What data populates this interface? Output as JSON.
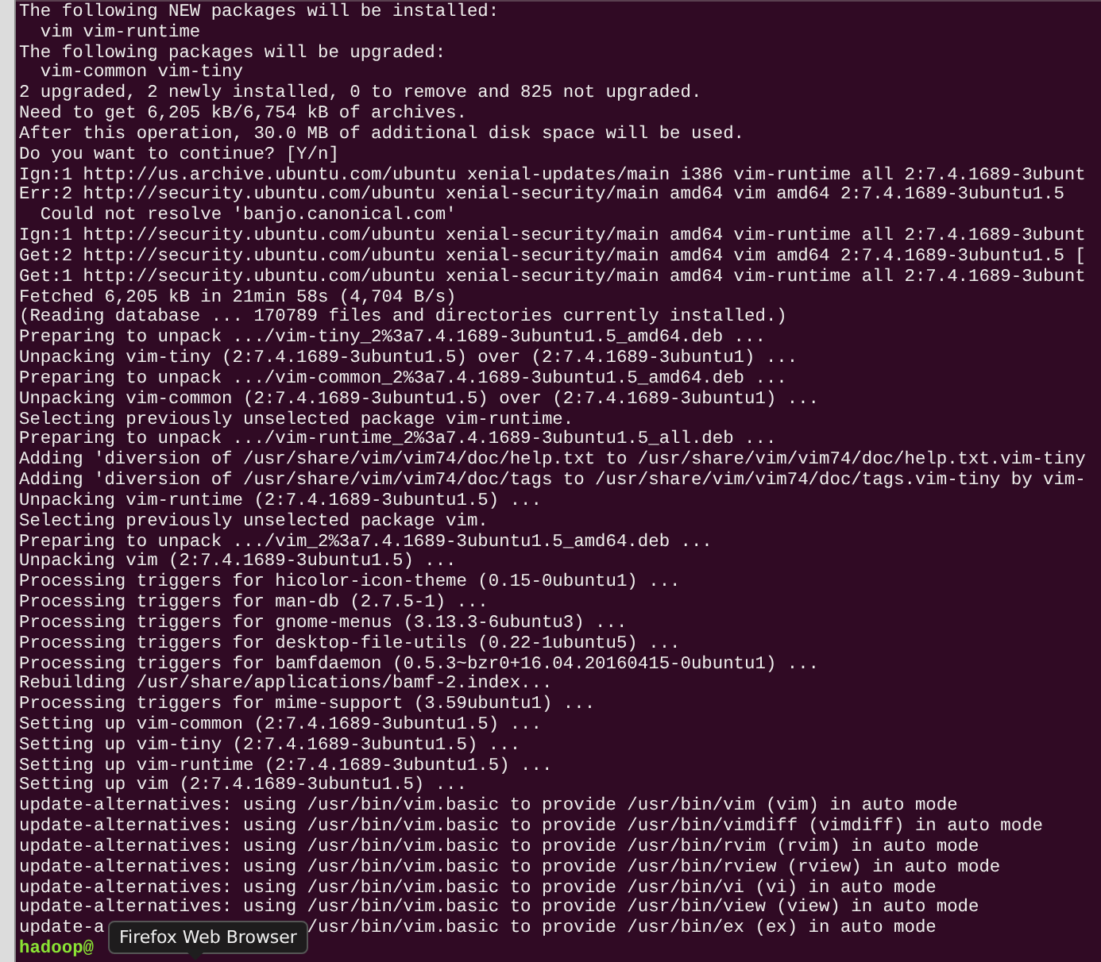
{
  "lines": [
    "The following NEW packages will be installed:",
    "  vim vim-runtime",
    "The following packages will be upgraded:",
    "  vim-common vim-tiny",
    "2 upgraded, 2 newly installed, 0 to remove and 825 not upgraded.",
    "Need to get 6,205 kB/6,754 kB of archives.",
    "After this operation, 30.0 MB of additional disk space will be used.",
    "Do you want to continue? [Y/n]",
    "Ign:1 http://us.archive.ubuntu.com/ubuntu xenial-updates/main i386 vim-runtime all 2:7.4.1689-3ubunt",
    "Err:2 http://security.ubuntu.com/ubuntu xenial-security/main amd64 vim amd64 2:7.4.1689-3ubuntu1.5",
    "  Could not resolve 'banjo.canonical.com'",
    "Ign:1 http://security.ubuntu.com/ubuntu xenial-security/main amd64 vim-runtime all 2:7.4.1689-3ubunt",
    "Get:2 http://security.ubuntu.com/ubuntu xenial-security/main amd64 vim amd64 2:7.4.1689-3ubuntu1.5 [",
    "Get:1 http://security.ubuntu.com/ubuntu xenial-security/main amd64 vim-runtime all 2:7.4.1689-3ubunt",
    "Fetched 6,205 kB in 21min 58s (4,704 B/s)",
    "(Reading database ... 170789 files and directories currently installed.)",
    "Preparing to unpack .../vim-tiny_2%3a7.4.1689-3ubuntu1.5_amd64.deb ...",
    "Unpacking vim-tiny (2:7.4.1689-3ubuntu1.5) over (2:7.4.1689-3ubuntu1) ...",
    "Preparing to unpack .../vim-common_2%3a7.4.1689-3ubuntu1.5_amd64.deb ...",
    "Unpacking vim-common (2:7.4.1689-3ubuntu1.5) over (2:7.4.1689-3ubuntu1) ...",
    "Selecting previously unselected package vim-runtime.",
    "Preparing to unpack .../vim-runtime_2%3a7.4.1689-3ubuntu1.5_all.deb ...",
    "Adding 'diversion of /usr/share/vim/vim74/doc/help.txt to /usr/share/vim/vim74/doc/help.txt.vim-tiny",
    "Adding 'diversion of /usr/share/vim/vim74/doc/tags to /usr/share/vim/vim74/doc/tags.vim-tiny by vim-",
    "Unpacking vim-runtime (2:7.4.1689-3ubuntu1.5) ...",
    "Selecting previously unselected package vim.",
    "Preparing to unpack .../vim_2%3a7.4.1689-3ubuntu1.5_amd64.deb ...",
    "Unpacking vim (2:7.4.1689-3ubuntu1.5) ...",
    "Processing triggers for hicolor-icon-theme (0.15-0ubuntu1) ...",
    "Processing triggers for man-db (2.7.5-1) ...",
    "Processing triggers for gnome-menus (3.13.3-6ubuntu3) ...",
    "Processing triggers for desktop-file-utils (0.22-1ubuntu5) ...",
    "Processing triggers for bamfdaemon (0.5.3~bzr0+16.04.20160415-0ubuntu1) ...",
    "Rebuilding /usr/share/applications/bamf-2.index...",
    "Processing triggers for mime-support (3.59ubuntu1) ...",
    "Setting up vim-common (2:7.4.1689-3ubuntu1.5) ...",
    "Setting up vim-tiny (2:7.4.1689-3ubuntu1.5) ...",
    "Setting up vim-runtime (2:7.4.1689-3ubuntu1.5) ...",
    "Setting up vim (2:7.4.1689-3ubuntu1.5) ...",
    "update-alternatives: using /usr/bin/vim.basic to provide /usr/bin/vim (vim) in auto mode",
    "update-alternatives: using /usr/bin/vim.basic to provide /usr/bin/vimdiff (vimdiff) in auto mode",
    "update-alternatives: using /usr/bin/vim.basic to provide /usr/bin/rvim (rvim) in auto mode",
    "update-alternatives: using /usr/bin/vim.basic to provide /usr/bin/rview (rview) in auto mode",
    "update-alternatives: using /usr/bin/vim.basic to provide /usr/bin/vi (vi) in auto mode",
    "update-alternatives: using /usr/bin/vim.basic to provide /usr/bin/view (view) in auto mode"
  ],
  "covered_line": {
    "before": "update-a",
    "after": "/usr/bin/vim.basic to provide /usr/bin/ex (ex) in auto mode"
  },
  "prompt": "hadoop@",
  "tooltip": "Firefox Web Browser"
}
